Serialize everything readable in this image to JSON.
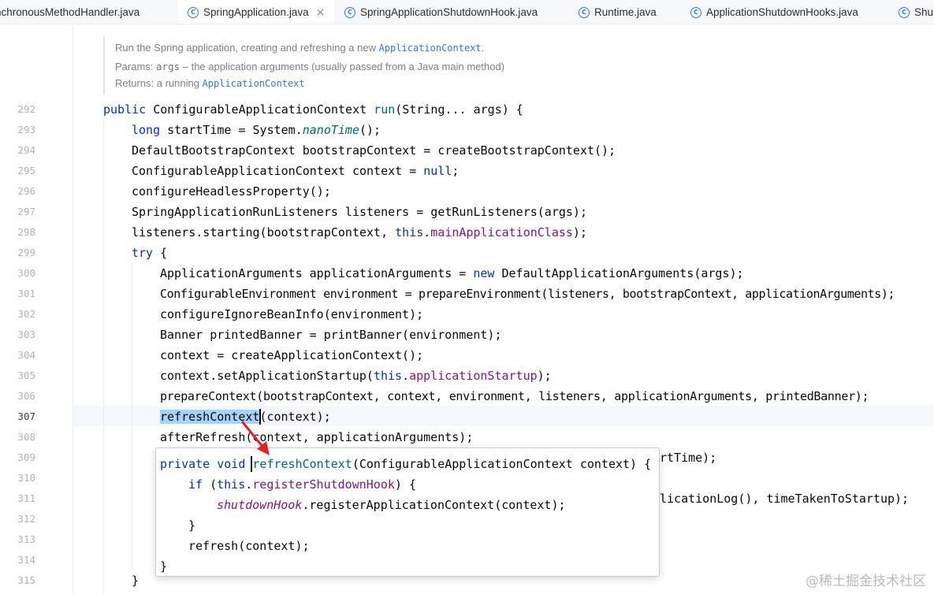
{
  "tabs": [
    {
      "label": "nchronousMethodHandler.java",
      "active": false,
      "icon": "class-icon"
    },
    {
      "label": "SpringApplication.java",
      "active": true,
      "icon": "class-icon",
      "close": "×"
    },
    {
      "label": "SpringApplicationShutdownHook.java",
      "active": false,
      "icon": "class-icon"
    },
    {
      "label": "Runtime.java",
      "active": false,
      "icon": "class-icon"
    },
    {
      "label": "ApplicationShutdownHooks.java",
      "active": false,
      "icon": "class-icon"
    },
    {
      "label": "Shu",
      "active": false,
      "icon": "class-icon"
    }
  ],
  "class_icon_glyph": "C",
  "doc": {
    "summary_text": "Run the Spring application, creating and refreshing a new ",
    "summary_code": "ApplicationContext",
    "summary_end": ".",
    "params_label": "Params:",
    "params_arg": "args",
    "params_text": " – the application arguments (usually passed from a Java main method)",
    "returns_label": "Returns:",
    "returns_text": " a running ",
    "returns_code": "ApplicationContext"
  },
  "line_numbers": [
    "292",
    "293",
    "294",
    "295",
    "296",
    "297",
    "298",
    "299",
    "300",
    "301",
    "302",
    "303",
    "304",
    "305",
    "306",
    "307",
    "308",
    "309",
    "310",
    "311",
    "312",
    "313",
    "314",
    "315"
  ],
  "current_line": "307",
  "code": {
    "l292": {
      "kw": "public",
      "t1": " ConfigurableApplicationContext ",
      "fn": "run",
      "t2": "(String... args) {"
    },
    "l293": {
      "kw": "long",
      "t1": " startTime = System.",
      "it": "nanoTime",
      "t2": "();"
    },
    "l294": {
      "t": "DefaultBootstrapContext bootstrapContext = createBootstrapContext();"
    },
    "l295": {
      "t1": "ConfigurableApplicationContext context = ",
      "kw": "null",
      "t2": ";"
    },
    "l296": {
      "t": "configureHeadlessProperty();"
    },
    "l297": {
      "t": "SpringApplicationRunListeners listeners = getRunListeners(args);"
    },
    "l298": {
      "t1": "listeners.starting(bootstrapContext, ",
      "kw": "this",
      "t2": ".",
      "fld": "mainApplicationClass",
      "t3": ");"
    },
    "l299": {
      "kw": "try",
      "t1": " {"
    },
    "l300": {
      "t1": "ApplicationArguments applicationArguments = ",
      "kw": "new",
      "t2": " DefaultApplicationArguments(args);"
    },
    "l301": {
      "t": "ConfigurableEnvironment environment = prepareEnvironment(listeners, bootstrapContext, applicationArguments);"
    },
    "l302": {
      "t": "configureIgnoreBeanInfo(environment);"
    },
    "l303": {
      "t": "Banner printedBanner = printBanner(environment);"
    },
    "l304": {
      "t": "context = createApplicationContext();"
    },
    "l305": {
      "t1": "context.setApplicationStartup(",
      "kw": "this",
      "t2": ".",
      "fld": "applicationStartup",
      "t3": ");"
    },
    "l306": {
      "t": "prepareContext(bootstrapContext, context, environment, listeners, applicationArguments, printedBanner);"
    },
    "l307": {
      "hl": "refreshContext",
      "t1": "(context);"
    },
    "l308": {
      "t": "afterRefresh(context, applicationArguments);"
    },
    "l309_tail": "rtTime);",
    "l311_tail": "licationLog(), timeTakenToStartup);",
    "l315": {
      "t": "}"
    }
  },
  "popup": {
    "p1": {
      "kw": "private void",
      "t0": " ",
      "fn": "refreshContext",
      "t1": "(ConfigurableApplicationContext context) {"
    },
    "p2": {
      "kw0": "if",
      "t0": " (",
      "kw": "this",
      "t1": ".",
      "fld": "registerShutdownHook",
      "t2": ") {"
    },
    "p3": {
      "fld": "shutdownHook",
      "t1": ".registerApplicationContext(context);"
    },
    "p4": {
      "t": "}"
    },
    "p5": {
      "t": "refresh(context);"
    },
    "p6": {
      "t": "}"
    }
  },
  "watermark": "@稀土掘金技术社区",
  "colors": {
    "keyword": "#0033b3",
    "method": "#00627a",
    "field": "#871094",
    "selection": "#a6d2ff",
    "arrow": "#e02424",
    "accent": "#3574f0"
  }
}
